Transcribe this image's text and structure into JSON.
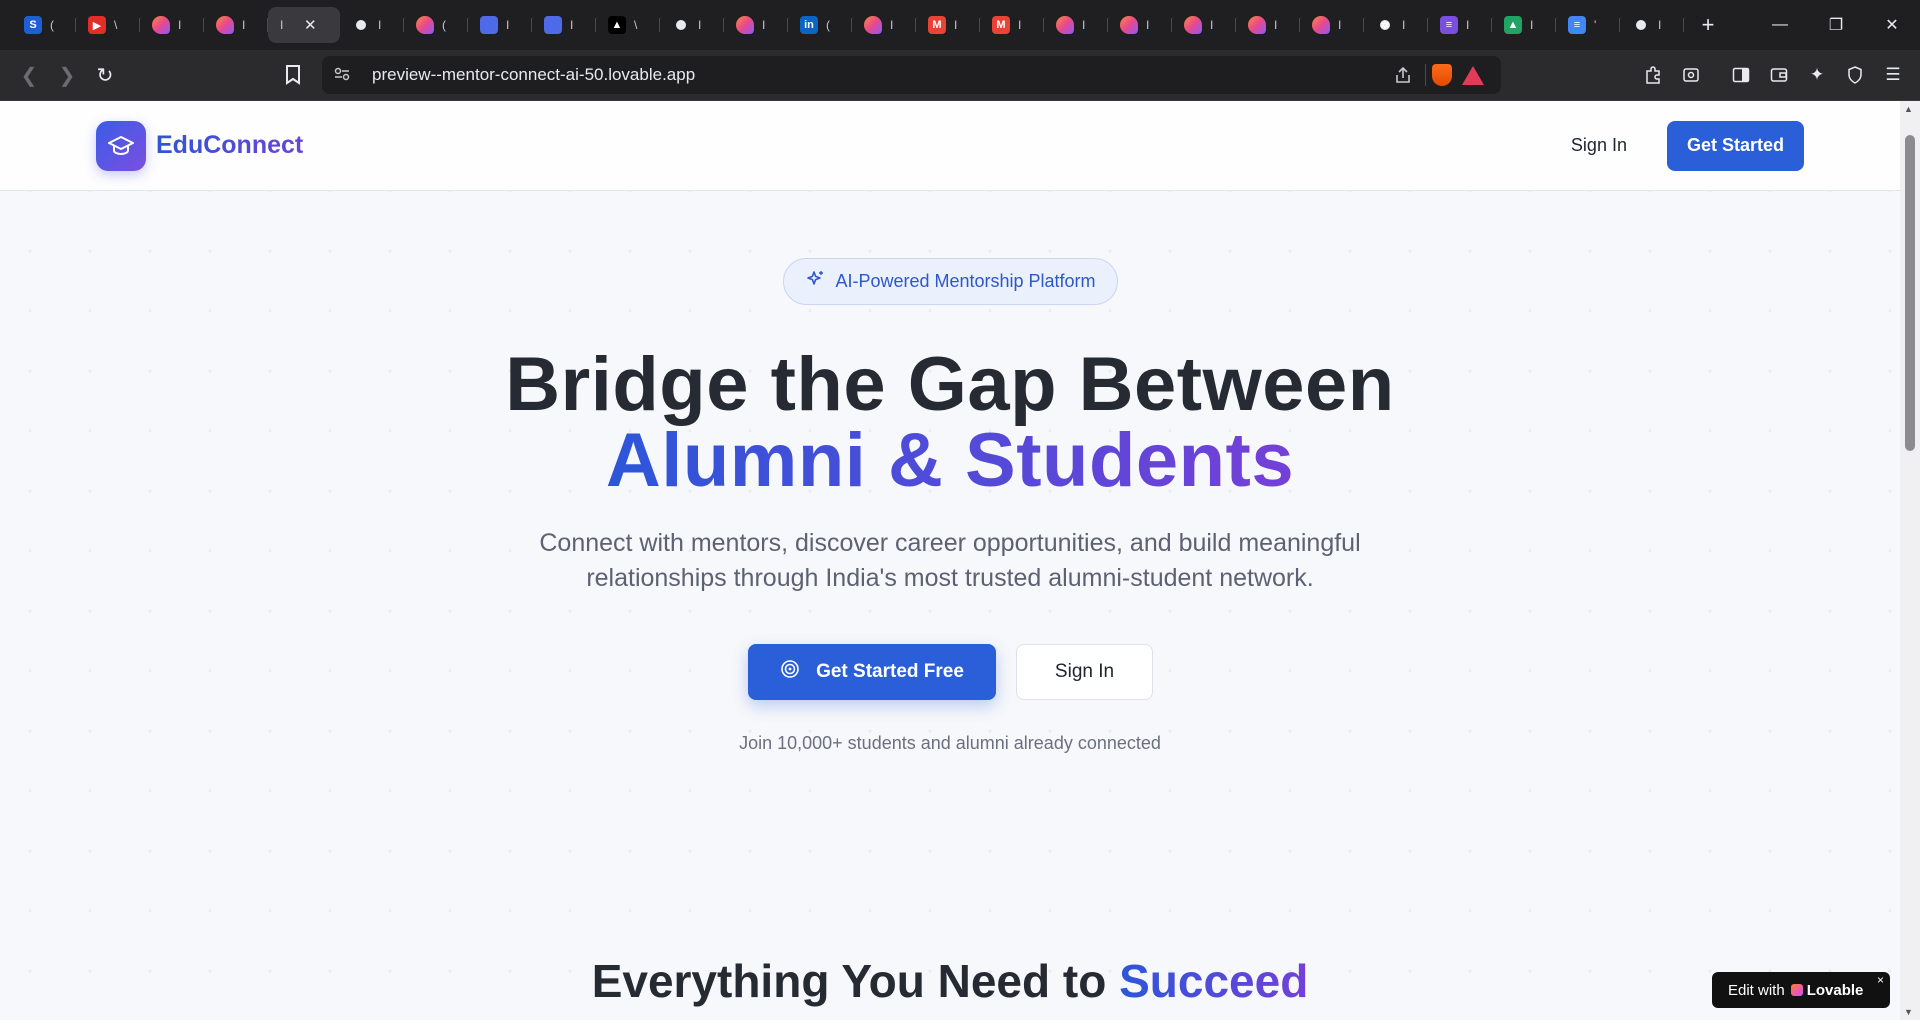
{
  "browser": {
    "tabs": [
      {
        "icon": "S",
        "color": "#1e5fd6",
        "title": "("
      },
      {
        "icon": "▶",
        "color": "#e52d27",
        "title": "\\"
      },
      {
        "icon": "",
        "color": "#e8588d",
        "title": "I"
      },
      {
        "icon": "",
        "color": "#e8588d",
        "title": "I"
      },
      {
        "icon": "",
        "color": "",
        "title": "I",
        "active": true
      },
      {
        "icon": "",
        "color": "#e8eaed",
        "title": "I"
      },
      {
        "icon": "",
        "color": "#e8588d",
        "title": "("
      },
      {
        "icon": "",
        "color": "#4f6ae8",
        "title": "I"
      },
      {
        "icon": "",
        "color": "#4f6ae8",
        "title": "I"
      },
      {
        "icon": "▲",
        "color": "#000000",
        "title": "\\"
      },
      {
        "icon": "",
        "color": "#e8eaed",
        "title": "I"
      },
      {
        "icon": "",
        "color": "#e8588d",
        "title": "I"
      },
      {
        "icon": "in",
        "color": "#0a66c2",
        "title": "("
      },
      {
        "icon": "",
        "color": "#e8588d",
        "title": "I"
      },
      {
        "icon": "M",
        "color": "#ea4335",
        "title": "I"
      },
      {
        "icon": "M",
        "color": "#ea4335",
        "title": "I"
      },
      {
        "icon": "",
        "color": "#e8588d",
        "title": "I"
      },
      {
        "icon": "",
        "color": "#e8588d",
        "title": "I"
      },
      {
        "icon": "",
        "color": "#e8588d",
        "title": "I"
      },
      {
        "icon": "",
        "color": "#e8588d",
        "title": "I"
      },
      {
        "icon": "",
        "color": "#e8588d",
        "title": "I"
      },
      {
        "icon": "✲",
        "color": "#e8eaed",
        "title": "I"
      },
      {
        "icon": "≡",
        "color": "#7a4fe0",
        "title": "I"
      },
      {
        "icon": "▲",
        "color": "#1fa463",
        "title": "I"
      },
      {
        "icon": "≡",
        "color": "#4285f4",
        "title": "'"
      },
      {
        "icon": "",
        "color": "#e8eaed",
        "title": "I"
      }
    ],
    "url": "preview--mentor-connect-ai-50.lovable.app"
  },
  "header": {
    "brand": "EduConnect",
    "signin_label": "Sign In",
    "get_started_label": "Get Started"
  },
  "hero": {
    "badge": "AI-Powered Mentorship Platform",
    "title_line1": "Bridge the Gap Between",
    "title_line2": "Alumni & Students",
    "subtitle_line1": "Connect with mentors, discover career opportunities, and build meaningful",
    "subtitle_line2": "relationships through India's most trusted alumni-student network.",
    "cta_primary": "Get Started Free",
    "cta_secondary": "Sign In",
    "social_proof": "Join 10,000+ students and alumni already connected"
  },
  "features": {
    "title_prefix": "Everything You Need to",
    "title_highlight": "Succeed"
  },
  "lovable_badge": {
    "prefix": "Edit with",
    "brand": "Lovable",
    "close": "×"
  },
  "colors": {
    "primary": "#2b5fd9",
    "gradient_start": "#2d56d8",
    "gradient_end": "#7440d8",
    "heading": "#262a33"
  }
}
